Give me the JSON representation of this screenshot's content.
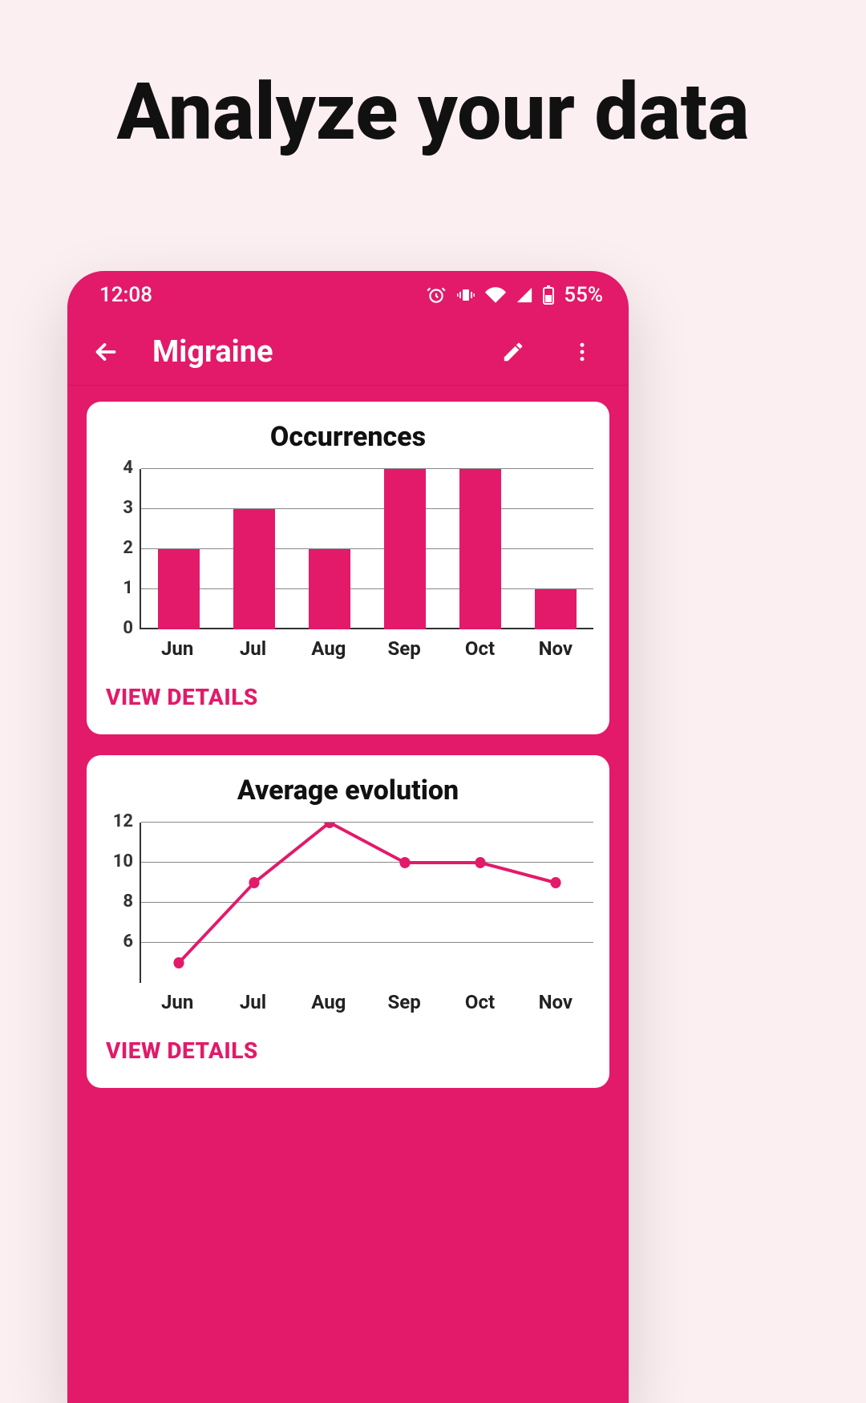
{
  "page": {
    "title": "Analyze your data"
  },
  "statusbar": {
    "time": "12:08",
    "battery": "55%"
  },
  "appbar": {
    "title": "Migraine",
    "back_label": "Back",
    "edit_label": "Edit",
    "menu_label": "More"
  },
  "cards": [
    {
      "title": "Occurrences",
      "view_details": "VIEW DETAILS",
      "chart": {
        "type": "bar",
        "categories": [
          "Jun",
          "Jul",
          "Aug",
          "Sep",
          "Oct",
          "Nov"
        ],
        "values": [
          2,
          3,
          2,
          4,
          4,
          1
        ],
        "yticks": [
          0,
          1,
          2,
          3,
          4
        ],
        "ylim": [
          0,
          4
        ]
      }
    },
    {
      "title": "Average evolution",
      "view_details": "VIEW DETAILS",
      "chart": {
        "type": "line",
        "categories": [
          "Jun",
          "Jul",
          "Aug",
          "Sep",
          "Oct",
          "Nov"
        ],
        "values": [
          5,
          9,
          12,
          10,
          10,
          9
        ],
        "yticks": [
          6,
          8,
          10,
          12
        ],
        "ylim": [
          4,
          12
        ]
      }
    }
  ],
  "chart_data": [
    {
      "type": "bar",
      "title": "Occurrences",
      "categories": [
        "Jun",
        "Jul",
        "Aug",
        "Sep",
        "Oct",
        "Nov"
      ],
      "values": [
        2,
        3,
        2,
        4,
        4,
        1
      ],
      "xlabel": "",
      "ylabel": "",
      "ylim": [
        0,
        4
      ]
    },
    {
      "type": "line",
      "title": "Average evolution",
      "categories": [
        "Jun",
        "Jul",
        "Aug",
        "Sep",
        "Oct",
        "Nov"
      ],
      "values": [
        5,
        9,
        12,
        10,
        10,
        9
      ],
      "xlabel": "",
      "ylabel": "",
      "ylim": [
        4,
        12
      ]
    }
  ],
  "colors": {
    "accent": "#e21a69",
    "page_bg": "#fceff2"
  }
}
